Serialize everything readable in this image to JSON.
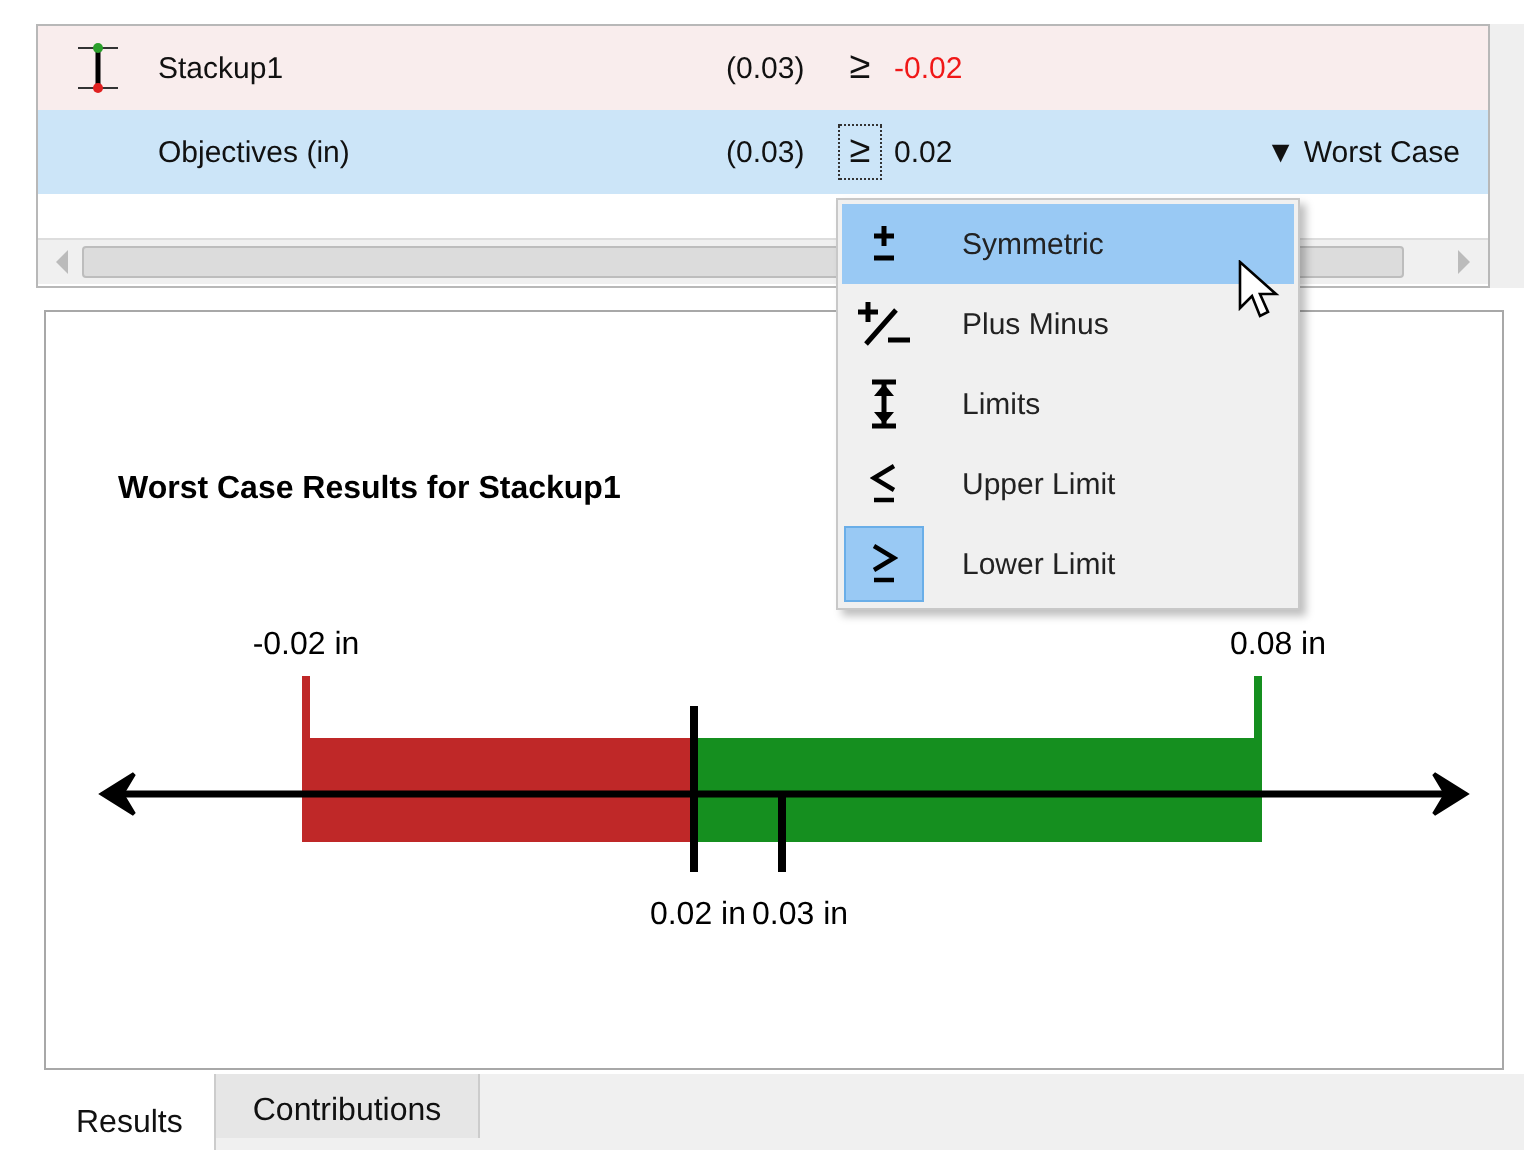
{
  "rows": [
    {
      "kind": "stackup",
      "name": "Stackup1",
      "nominal": "(0.03)",
      "operator": "≥",
      "limit": "-0.02",
      "failing": true,
      "selected": false,
      "focused": false
    },
    {
      "kind": "objective",
      "name": "Objectives (in)",
      "nominal": "(0.03)",
      "operator": "≥",
      "limit": "0.02",
      "failing": false,
      "selected": true,
      "focused": true,
      "method": "▼ Worst Case"
    }
  ],
  "menu": {
    "items": [
      {
        "kind": "symmetric",
        "label": "Symmetric",
        "hovered": true,
        "checked": false
      },
      {
        "kind": "plus_minus",
        "label": "Plus Minus",
        "hovered": false,
        "checked": false
      },
      {
        "kind": "limits",
        "label": "Limits",
        "hovered": false,
        "checked": false
      },
      {
        "kind": "upper",
        "label": "Upper Limit",
        "hovered": false,
        "checked": false
      },
      {
        "kind": "lower",
        "label": "Lower Limit",
        "hovered": false,
        "checked": true
      }
    ]
  },
  "chart": {
    "title": "Worst Case Results for Stackup1",
    "markers": [
      {
        "kind": "min",
        "label": "-0.02 in"
      },
      {
        "kind": "max",
        "label": "0.08 in"
      },
      {
        "kind": "target",
        "label": "0.02 in"
      },
      {
        "kind": "nominal",
        "label": "0.03 in"
      }
    ]
  },
  "tabs": [
    {
      "label": "Results",
      "selected": true
    },
    {
      "label": "Contributions",
      "selected": false
    }
  ]
}
